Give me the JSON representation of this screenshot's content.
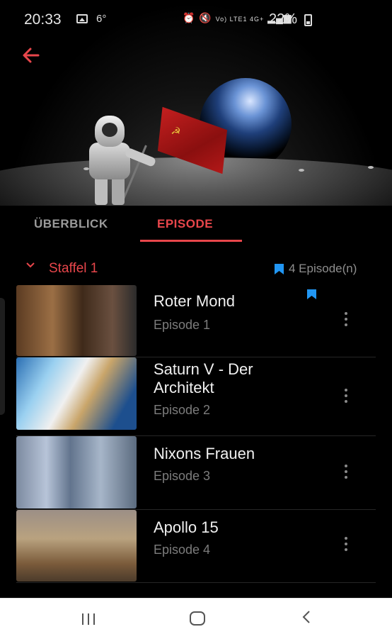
{
  "status_bar": {
    "time": "20:33",
    "temperature": "6°",
    "network": "Vo) LTE1 4G+",
    "battery": "22%"
  },
  "header": {
    "back_icon": "arrow-left-icon"
  },
  "tabs": [
    {
      "label": "ÜBERBLICK",
      "active": false
    },
    {
      "label": "EPISODE",
      "active": true
    }
  ],
  "season": {
    "label": "Staffel 1",
    "episode_count": "4 Episode(n)"
  },
  "episodes": [
    {
      "title": "Roter Mond",
      "subtitle": "Episode 1",
      "bookmarked": true
    },
    {
      "title": "Saturn V - Der Architekt",
      "subtitle": "Episode 2",
      "bookmarked": false
    },
    {
      "title": "Nixons Frauen",
      "subtitle": "Episode 3",
      "bookmarked": false
    },
    {
      "title": "Apollo 15",
      "subtitle": "Episode 4",
      "bookmarked": false
    }
  ],
  "colors": {
    "accent": "#e8464b",
    "bookmark": "#2196f3",
    "background": "#000000"
  }
}
